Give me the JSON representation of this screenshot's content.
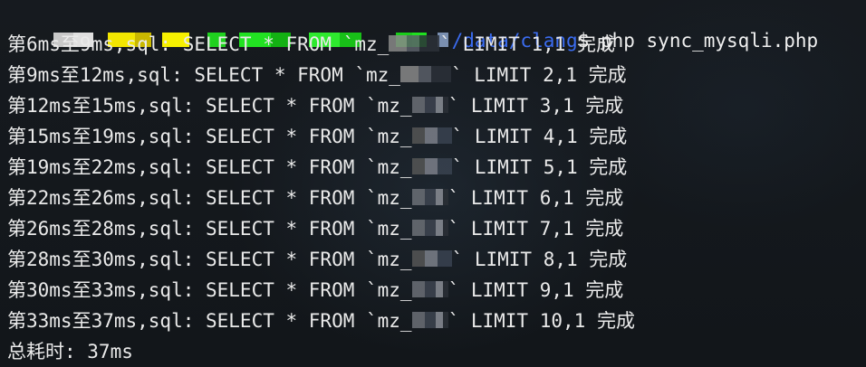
{
  "prompt": {
    "path": "/data/clang",
    "symbol": "$",
    "command": "php sync_mysqli.php"
  },
  "log_lines": [
    {
      "prefix": "第6ms至9ms,sql: SELECT * FROM `mz_",
      "suffix": "` LIMIT 1,1 完成"
    },
    {
      "prefix": "第9ms至12ms,sql: SELECT * FROM `mz_",
      "suffix": "` LIMIT 2,1 完成"
    },
    {
      "prefix": "第12ms至15ms,sql: SELECT * FROM `mz_",
      "suffix": "` LIMIT 3,1 完成"
    },
    {
      "prefix": "第15ms至19ms,sql: SELECT * FROM `mz_",
      "suffix": "` LIMIT 4,1 完成"
    },
    {
      "prefix": "第19ms至22ms,sql: SELECT * FROM `mz_",
      "suffix": "` LIMIT 5,1 完成"
    },
    {
      "prefix": "第22ms至26ms,sql: SELECT * FROM `mz_",
      "suffix": "` LIMIT 6,1 完成"
    },
    {
      "prefix": "第26ms至28ms,sql: SELECT * FROM `mz_",
      "suffix": "` LIMIT 7,1 完成"
    },
    {
      "prefix": "第28ms至30ms,sql: SELECT * FROM `mz_",
      "suffix": "` LIMIT 8,1 完成"
    },
    {
      "prefix": "第30ms至33ms,sql: SELECT * FROM `mz_",
      "suffix": "` LIMIT 9,1 完成"
    },
    {
      "prefix": "第33ms至37ms,sql: SELECT * FROM `mz_",
      "suffix": "` LIMIT 10,1 完成"
    }
  ],
  "total": "总耗时: 37ms",
  "colors": {
    "path": "#3b6cf0",
    "text": "#eaeaea",
    "background": "#14181d"
  }
}
